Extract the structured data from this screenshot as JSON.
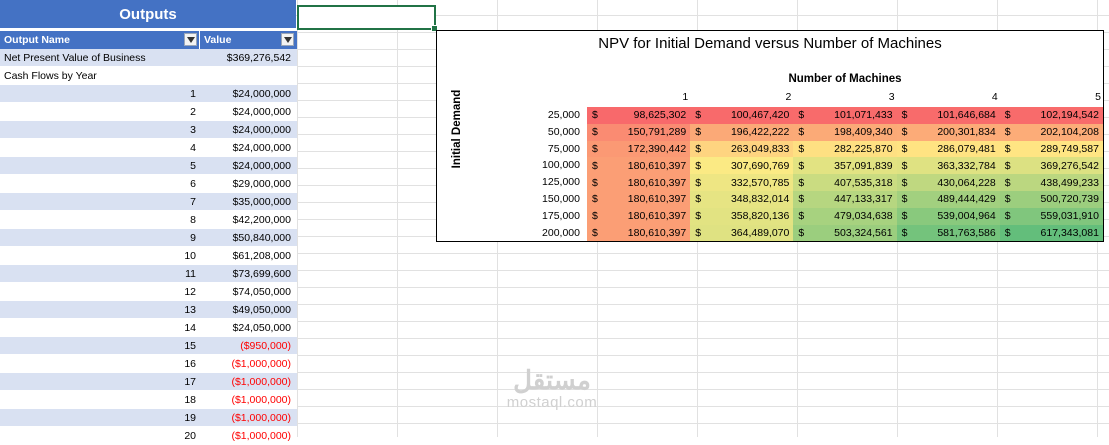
{
  "outputs": {
    "title": "Outputs",
    "col_name": "Output Name",
    "col_value": "Value",
    "npv_label": "Net Present Value of Business",
    "npv_value": "$369,276,542",
    "cashflows_label": "Cash Flows by Year",
    "cash_flows": [
      {
        "year": "1",
        "value": "$24,000,000",
        "negative": false
      },
      {
        "year": "2",
        "value": "$24,000,000",
        "negative": false
      },
      {
        "year": "3",
        "value": "$24,000,000",
        "negative": false
      },
      {
        "year": "4",
        "value": "$24,000,000",
        "negative": false
      },
      {
        "year": "5",
        "value": "$24,000,000",
        "negative": false
      },
      {
        "year": "6",
        "value": "$29,000,000",
        "negative": false
      },
      {
        "year": "7",
        "value": "$35,000,000",
        "negative": false
      },
      {
        "year": "8",
        "value": "$42,200,000",
        "negative": false
      },
      {
        "year": "9",
        "value": "$50,840,000",
        "negative": false
      },
      {
        "year": "10",
        "value": "$61,208,000",
        "negative": false
      },
      {
        "year": "11",
        "value": "$73,699,600",
        "negative": false
      },
      {
        "year": "12",
        "value": "$74,050,000",
        "negative": false
      },
      {
        "year": "13",
        "value": "$49,050,000",
        "negative": false
      },
      {
        "year": "14",
        "value": "$24,050,000",
        "negative": false
      },
      {
        "year": "15",
        "value": "($950,000)",
        "negative": true
      },
      {
        "year": "16",
        "value": "($1,000,000)",
        "negative": true
      },
      {
        "year": "17",
        "value": "($1,000,000)",
        "negative": true
      },
      {
        "year": "18",
        "value": "($1,000,000)",
        "negative": true
      },
      {
        "year": "19",
        "value": "($1,000,000)",
        "negative": true
      },
      {
        "year": "20",
        "value": "($1,000,000)",
        "negative": true
      }
    ]
  },
  "npv_table": {
    "title": "NPV for Initial Demand versus Number of Machines",
    "col_axis_label": "Number of Machines",
    "row_axis_label": "Initial Demand",
    "currency_symbol": "$",
    "machines": [
      "1",
      "2",
      "3",
      "4",
      "5"
    ],
    "demands": [
      "25,000",
      "50,000",
      "75,000",
      "100,000",
      "125,000",
      "150,000",
      "175,000",
      "200,000"
    ],
    "values": [
      [
        "98,625,302",
        "100,467,420",
        "101,071,433",
        "101,646,684",
        "102,194,542"
      ],
      [
        "150,791,289",
        "196,422,222",
        "198,409,340",
        "200,301,834",
        "202,104,208"
      ],
      [
        "172,390,442",
        "263,049,833",
        "282,225,870",
        "286,079,481",
        "289,749,587"
      ],
      [
        "180,610,397",
        "307,690,769",
        "357,091,839",
        "363,332,784",
        "369,276,542"
      ],
      [
        "180,610,397",
        "332,570,785",
        "407,535,318",
        "430,064,228",
        "438,499,233"
      ],
      [
        "180,610,397",
        "348,832,014",
        "447,133,317",
        "489,444,429",
        "500,720,739"
      ],
      [
        "180,610,397",
        "358,820,136",
        "479,034,638",
        "539,004,964",
        "559,031,910"
      ],
      [
        "180,610,397",
        "364,489,070",
        "503,324,561",
        "581,763,586",
        "617,343,081"
      ]
    ],
    "color_scale": {
      "low": "#f8696b",
      "mid": "#ffeb84",
      "high": "#63be7b"
    }
  },
  "watermark": {
    "arabic": "مستقل",
    "latin": "mostaql.com"
  }
}
